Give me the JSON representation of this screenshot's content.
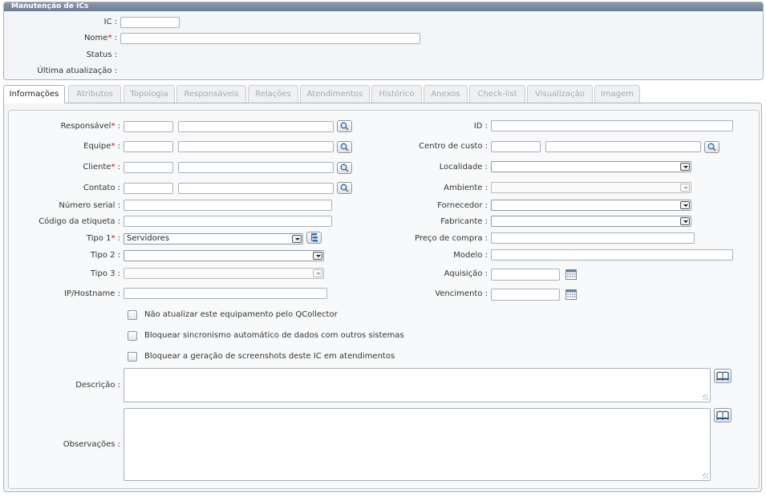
{
  "header": {
    "title": "Manutenção de ICs",
    "fields": {
      "ic_label": "IC :",
      "nome_label": "Nome",
      "nome_suffix": " :",
      "status_label": "Status :",
      "ultima_label": "Última atualização :"
    }
  },
  "required_mark": "*",
  "tabs": [
    "Informações",
    "Atributos",
    "Topologia",
    "Responsáveis",
    "Relações",
    "Atendimentos",
    "Histórico",
    "Anexos",
    "Check-list",
    "Visualização",
    "Imagem"
  ],
  "form": {
    "responsavel_label": "Responsável",
    "equipe_label": "Equipe",
    "cliente_label": "Cliente",
    "contato_label": "Contato :",
    "numero_serial_label": "Número serial :",
    "codigo_etiqueta_label": "Código da etiqueta :",
    "tipo1_label": "Tipo 1",
    "tipo1_value": "Servidores",
    "tipo2_label": "Tipo 2 :",
    "tipo3_label": "Tipo 3 :",
    "ip_label": "IP/Hostname :",
    "colon": " :",
    "id_label": "ID :",
    "centro_custo_label": "Centro de custo :",
    "localidade_label": "Localidade :",
    "ambiente_label": "Ambiente :",
    "fornecedor_label": "Fornecedor :",
    "fabricante_label": "Fabricante :",
    "preco_label": "Preço de compra :",
    "modelo_label": "Modelo :",
    "aquisicao_label": "Aquisição :",
    "vencimento_label": "Vencimento :",
    "checkbox1": "Não atualizar este equipamento pelo QCollector",
    "checkbox2": "Bloquear sincronismo automático de dados com outros sistemas",
    "checkbox3": "Bloquear a geração de screenshots deste IC em atendimentos",
    "descricao_label": "Descrição :",
    "observacoes_label": "Observações :"
  },
  "icons": {
    "lookup": "magnifier-icon",
    "tree": "tree-list-icon",
    "calendar": "calendar-icon",
    "book": "book-icon"
  }
}
